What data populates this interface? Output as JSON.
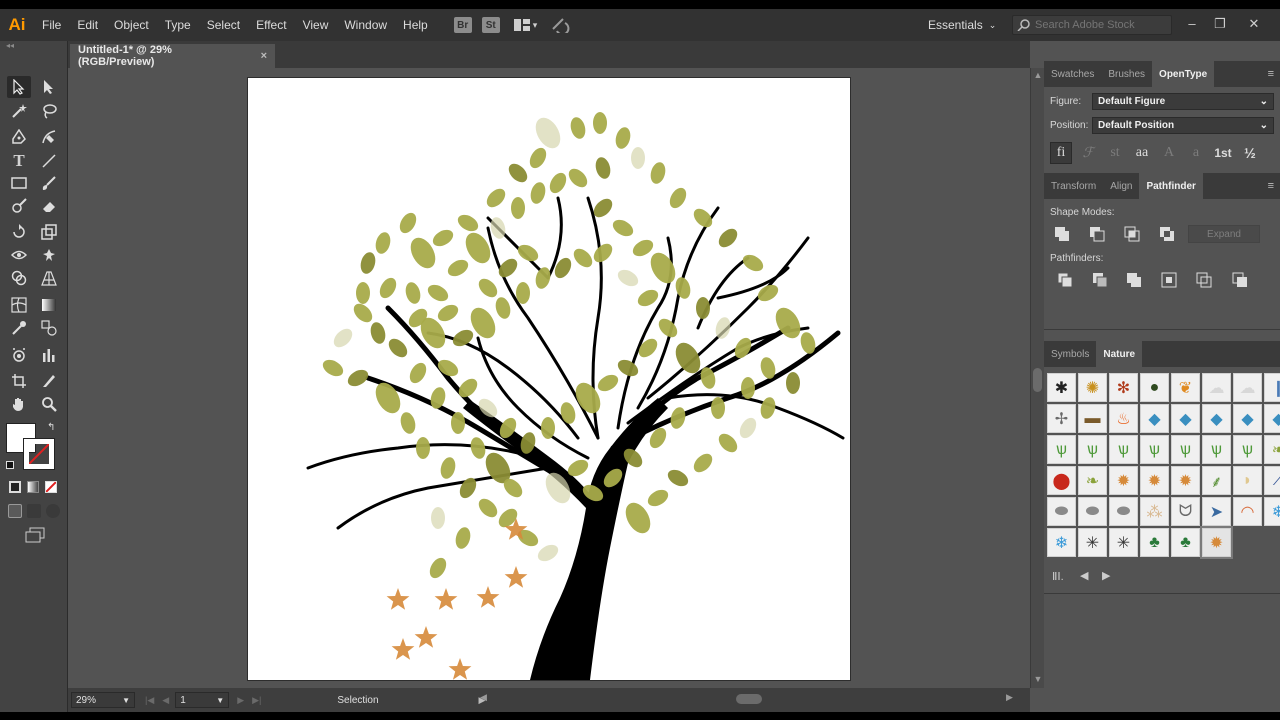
{
  "app": {
    "logo_text": "Ai"
  },
  "menu": [
    "File",
    "Edit",
    "Object",
    "Type",
    "Select",
    "Effect",
    "View",
    "Window",
    "Help"
  ],
  "app_buttons": [
    "Br",
    "St"
  ],
  "workspace": {
    "label": "Essentials"
  },
  "search": {
    "placeholder": "Search Adobe Stock"
  },
  "window_controls": {
    "minimize": "–",
    "restore": "❐",
    "close": "✕"
  },
  "document": {
    "tab_title": "Untitled-1* @ 29% (RGB/Preview)",
    "close": "×"
  },
  "status": {
    "zoom": "29%",
    "artboard": "1",
    "tool": "Selection"
  },
  "opentype_panel": {
    "tabs": [
      "Swatches",
      "Brushes",
      "OpenType"
    ],
    "active_tab": "OpenType",
    "figure_label": "Figure:",
    "figure_value": "Default Figure",
    "position_label": "Position:",
    "position_value": "Default Position",
    "glyph_buttons": [
      "fi",
      "ℱ",
      "st",
      "aa",
      "A",
      "a",
      "1st",
      "½"
    ]
  },
  "pathfinder_panel": {
    "tabs": [
      "Transform",
      "Align",
      "Pathfinder"
    ],
    "active_tab": "Pathfinder",
    "shape_modes_label": "Shape Modes:",
    "expand_label": "Expand",
    "pathfinders_label": "Pathfinders:"
  },
  "symbols_panel": {
    "tabs": [
      "Symbols",
      "Nature"
    ],
    "active_tab": "Nature",
    "symbols": [
      [
        "ant-icon",
        "bee-icon",
        "bug-icon",
        "beetle-icon",
        "butterfly-icon",
        "cloud-icon",
        "cloud-icon",
        "raindrop-icon"
      ],
      [
        "dragonfly-icon",
        "log-icon",
        "fire-icon",
        "fish-icon",
        "fish-icon",
        "fish-icon",
        "fish-icon",
        "fish-icon"
      ],
      [
        "grass-icon",
        "grass-icon",
        "grass-icon",
        "grass-icon",
        "grass-icon",
        "grass-icon",
        "grass-icon",
        "leaf-icon"
      ],
      [
        "ladybug-icon",
        "leaf-icon",
        "maple-leaf-icon",
        "maple-leaf-icon",
        "maple-leaf-icon",
        "fern-icon",
        "shell-icon",
        "feather-icon"
      ],
      [
        "rock-icon",
        "rock-icon",
        "rock-icon",
        "sand-icon",
        "scorpion-icon",
        "shark-icon",
        "rainbow-icon",
        "snowflake-icon"
      ],
      [
        "snowflake-icon",
        "spider-icon",
        "spider-icon",
        "tree-icon",
        "tree-icon",
        "maple-leaf-icon"
      ]
    ]
  },
  "colors": {
    "leaf": "#a8ab4a",
    "leaf_dark": "#8a8c34",
    "leaf_light": "#d6d5ae",
    "trunk": "#000000",
    "maple": "#d68a3a",
    "accent_logo": "#ff9a00"
  }
}
